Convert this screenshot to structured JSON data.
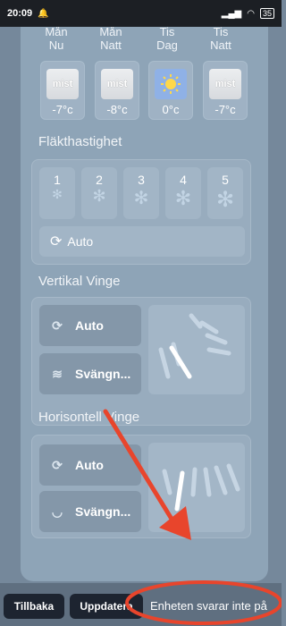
{
  "statusbar": {
    "time": "20:09",
    "battery": "35"
  },
  "forecast": [
    {
      "day": "Mån",
      "part": "Nu",
      "icon": "mist",
      "temp": "-7°c"
    },
    {
      "day": "Mån",
      "part": "Natt",
      "icon": "mist",
      "temp": "-8°c"
    },
    {
      "day": "Tis",
      "part": "Dag",
      "icon": "sun",
      "temp": "0°c"
    },
    {
      "day": "Tis",
      "part": "Natt",
      "icon": "mist",
      "temp": "-7°c"
    }
  ],
  "fan": {
    "title": "Fläkthastighet",
    "speeds": [
      "1",
      "2",
      "3",
      "4",
      "5"
    ],
    "auto_label": "Auto"
  },
  "vertical": {
    "title": "Vertikal Vinge",
    "auto_label": "Auto",
    "swing_label": "Svängn..."
  },
  "horizontal": {
    "title": "Horisontell Vinge",
    "auto_label": "Auto",
    "swing_label": "Svängn..."
  },
  "bottom": {
    "back_label": "Tillbaka",
    "update_label": "Uppdatera",
    "status_message": "Enheten svarar inte på"
  },
  "colors": {
    "annotation": "#e8452c",
    "accent": "#8ea4b7"
  }
}
